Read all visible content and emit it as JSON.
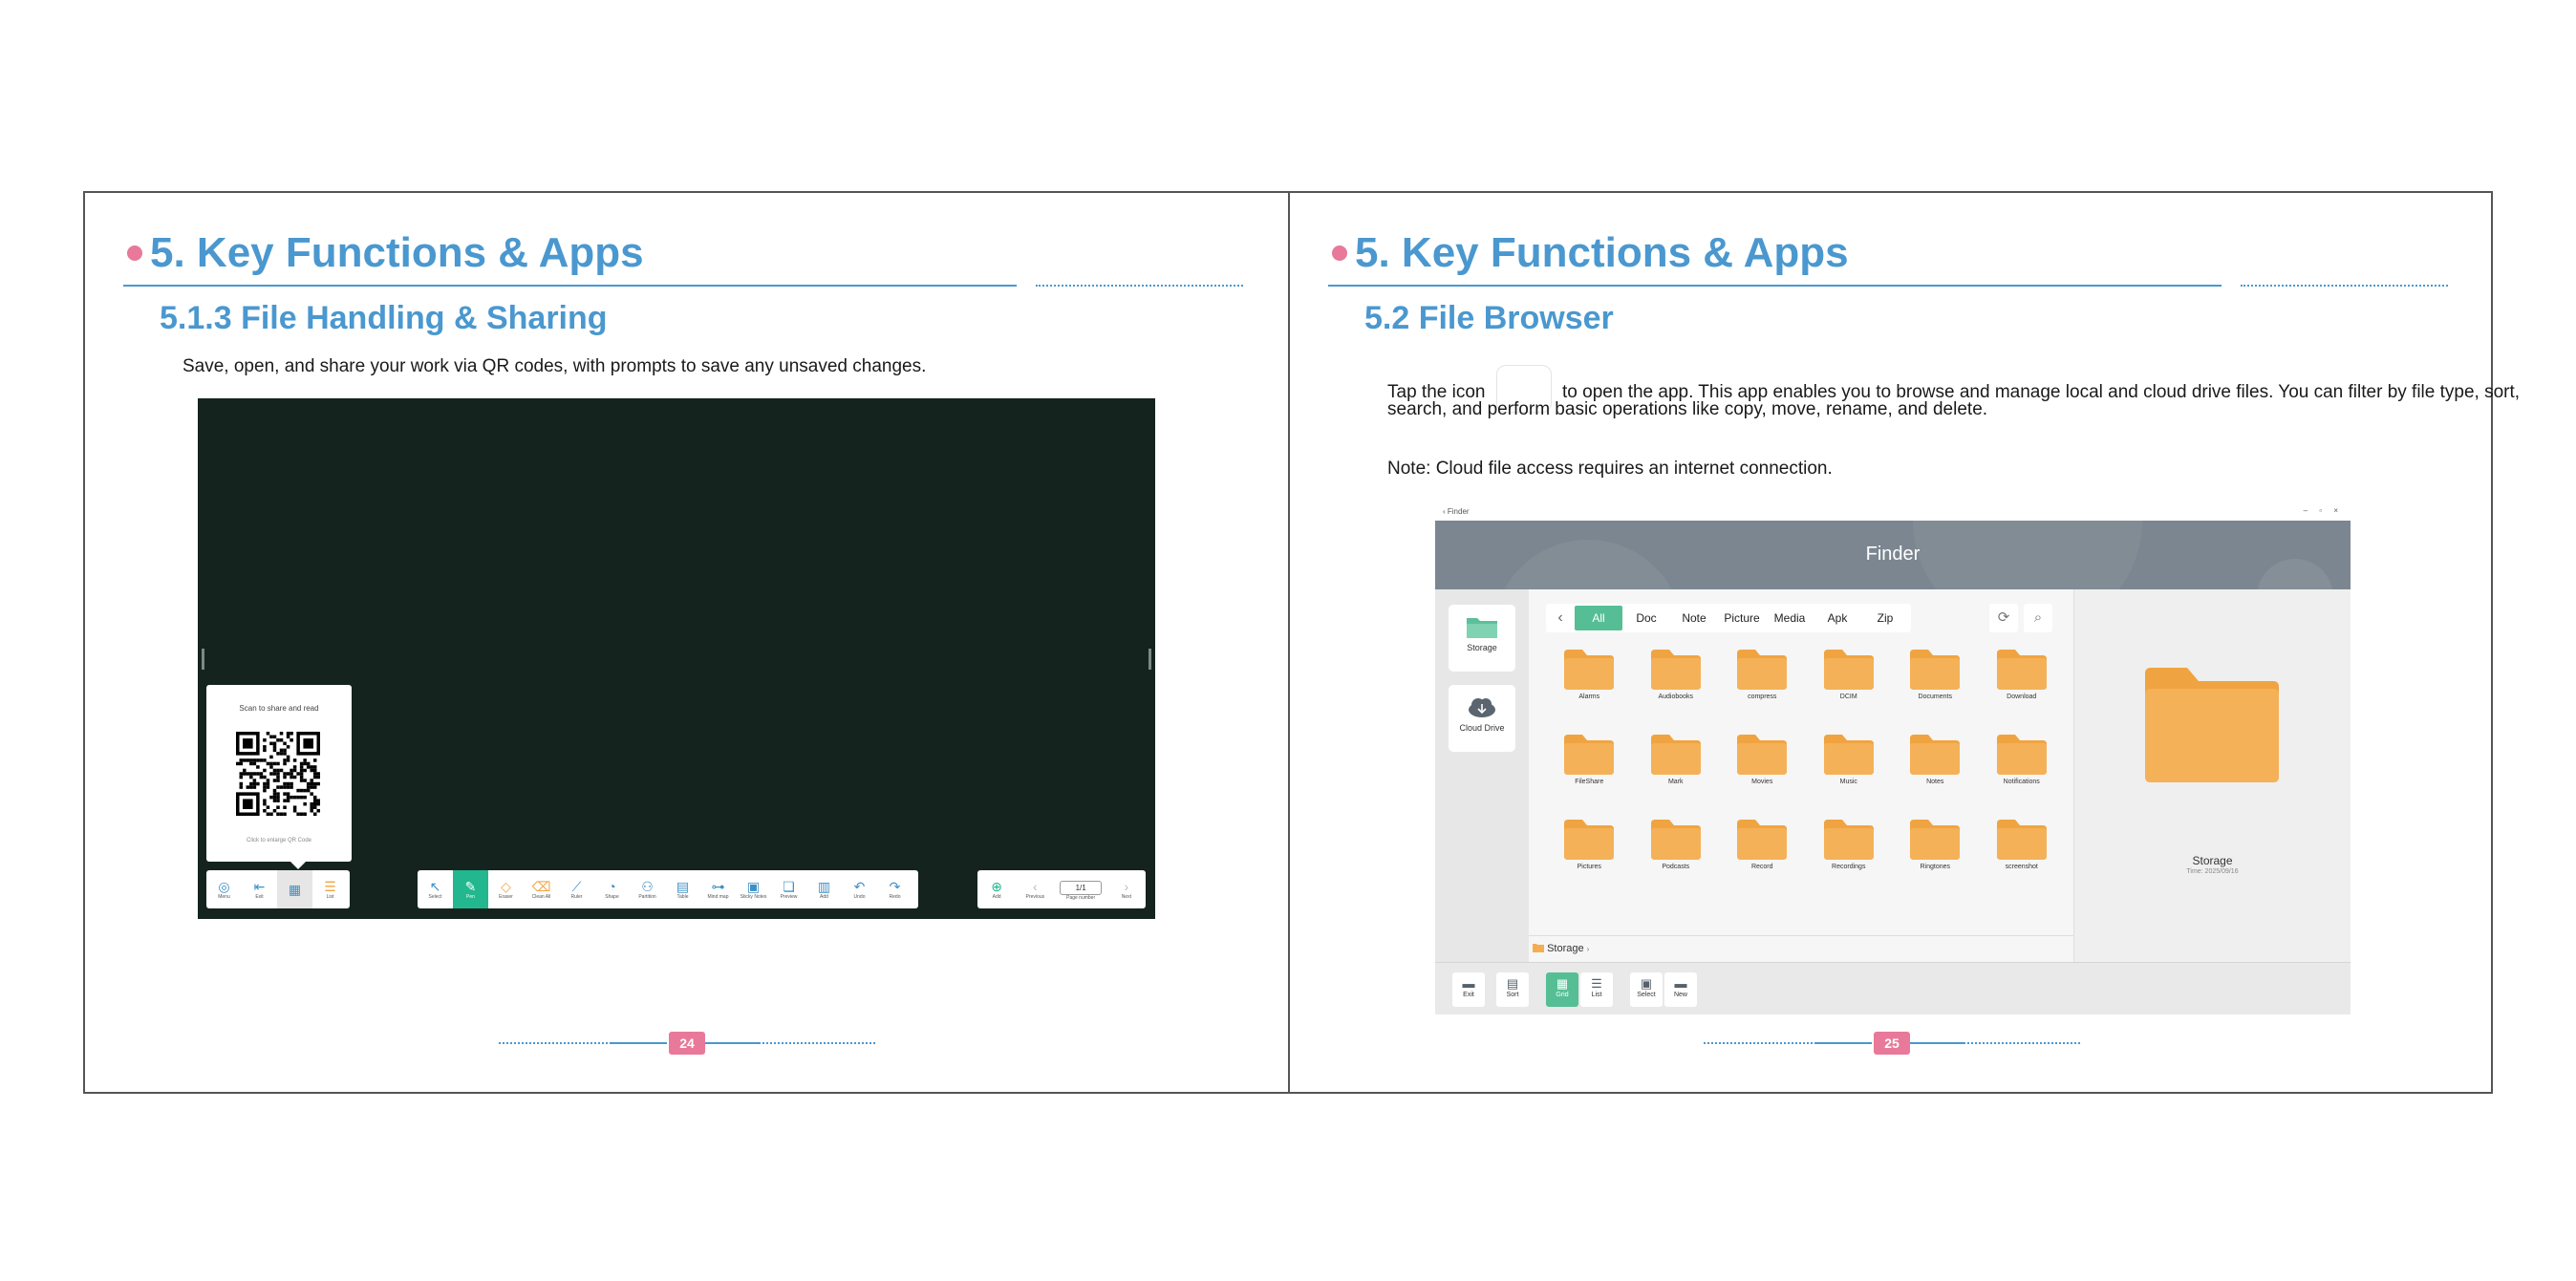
{
  "left_page": {
    "chapter_title": "5. Key Functions & Apps",
    "section_title": "5.1.3 File Handling & Sharing",
    "body": "Save, open, and share your work via QR codes, with prompts to save any unsaved changes.",
    "screenshot": {
      "qr_popup": {
        "title": "Scan to share and read",
        "hint": "Click to enlarge QR Code"
      },
      "toolbar_left": [
        {
          "label": "Menu",
          "icon": "menu-icon"
        },
        {
          "label": "Exit",
          "icon": "exit-icon"
        },
        {
          "label": "",
          "icon": "qr-icon"
        },
        {
          "label": "List",
          "icon": "list-icon"
        }
      ],
      "toolbar_center": [
        {
          "label": "Select",
          "icon": "select-icon"
        },
        {
          "label": "Pen",
          "icon": "pen-icon"
        },
        {
          "label": "Eraser",
          "icon": "eraser-icon"
        },
        {
          "label": "Clean All",
          "icon": "clean-icon"
        },
        {
          "label": "Ruler",
          "icon": "ruler-icon"
        },
        {
          "label": "Shape",
          "icon": "shape-icon"
        },
        {
          "label": "Partition",
          "icon": "partition-icon"
        },
        {
          "label": "Table",
          "icon": "table-icon"
        },
        {
          "label": "Mind map",
          "icon": "mindmap-icon"
        },
        {
          "label": "Sticky Notes",
          "icon": "sticky-icon"
        },
        {
          "label": "Preview",
          "icon": "preview-icon"
        },
        {
          "label": "Add",
          "icon": "add-icon"
        },
        {
          "label": "Undo",
          "icon": "undo-icon"
        },
        {
          "label": "Redo",
          "icon": "redo-icon"
        }
      ],
      "toolbar_right": {
        "add": "Add",
        "previous": "Previous",
        "page_value": "1/1",
        "page_number": "Page number",
        "next": "Next"
      }
    },
    "page_number": "24"
  },
  "right_page": {
    "chapter_title": "5. Key Functions & Apps",
    "section_title": "5.2 File Browser",
    "body_before_icon": "Tap the icon",
    "body_after_icon": "to open the app. This app enables you to browse and manage local and cloud drive files. You can filter by file type, sort,",
    "body_line2": "search, and perform basic operations like copy, move, rename, and delete.",
    "note": "Note: Cloud file access requires an internet connection.",
    "screenshot": {
      "window_title": "Finder",
      "header_title": "Finder",
      "sidebar": [
        {
          "label": "Storage",
          "icon": "folder-icon"
        },
        {
          "label": "Cloud Drive",
          "icon": "cloud-icon"
        }
      ],
      "filters": [
        "All",
        "Doc",
        "Note",
        "Picture",
        "Media",
        "Apk",
        "Zip"
      ],
      "folders": [
        "Alarms",
        "Audiobooks",
        "compress",
        "DCIM",
        "Documents",
        "Download",
        "FileShare",
        "Mark",
        "Movies",
        "Music",
        "Notes",
        "Notifications",
        "Pictures",
        "Podcasts",
        "Record",
        "Recordings",
        "Ringtones",
        "screenshot"
      ],
      "breadcrumb": "Storage",
      "preview": {
        "name": "Storage",
        "date": "Time: 2025/09/16"
      },
      "bottom_buttons": [
        "Exit",
        "Sort",
        "Grid",
        "List",
        "Select",
        "New"
      ]
    },
    "page_number": "25"
  },
  "colors": {
    "accent_blue": "#4a98cf",
    "accent_pink": "#e8799a",
    "board_bg": "#14231e",
    "active_green": "#22b78f",
    "folder_orange": "#f5ad52"
  }
}
